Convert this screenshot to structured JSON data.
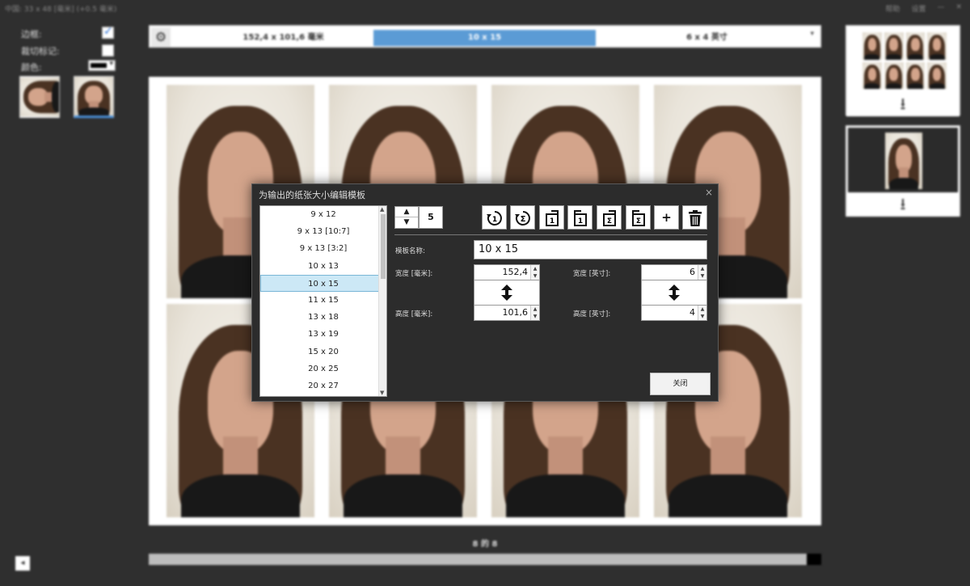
{
  "window": {
    "title": "中国: 33 x 48 [毫米] (+0.5 毫米)",
    "controls": [
      "帮助",
      "设置",
      "—",
      "✕"
    ]
  },
  "options": {
    "border_label": "边框:",
    "border_checked": true,
    "cut_marks_label": "裁切标记:",
    "cut_marks_checked": false,
    "color_label": "颜色:",
    "color_value": "#000000"
  },
  "paper_sizes": {
    "options": [
      "152,4 x 101,6 毫米",
      "10 x 15",
      "6 x 4 英寸"
    ],
    "selected": "10 x 15"
  },
  "sheet": {
    "count_text": "8 的 8"
  },
  "progress": {
    "value_percent": 97
  },
  "dialog": {
    "title": "为输出的纸张大小编辑模板",
    "close_glyph": "×",
    "sizes": [
      "9 x 12",
      "9 x 13 [10:7]",
      "9 x 13 [3:2]",
      "10 x 13",
      "10 x 15",
      "11 x 15",
      "13 x 18",
      "13 x 19",
      "15 x 20",
      "20 x 25",
      "20 x 27"
    ],
    "selected_size": "10 x 15",
    "count_value": "5",
    "toolbar": {
      "add_glyph": "+"
    },
    "template_name_label": "模板名称:",
    "template_name_value": "10 x 15",
    "width_mm_label": "宽度 [毫米]:",
    "width_mm_value": "152,4",
    "height_mm_label": "高度 [毫米]:",
    "height_mm_value": "101,6",
    "width_in_label": "宽度 [英寸]:",
    "width_in_value": "6",
    "height_in_label": "高度 [英寸]:",
    "height_in_value": "4",
    "close_button": "关闭"
  },
  "colors": {
    "background": "#2f2f2f",
    "accent": "#5b9bd5",
    "selection": "#cce8f6"
  }
}
